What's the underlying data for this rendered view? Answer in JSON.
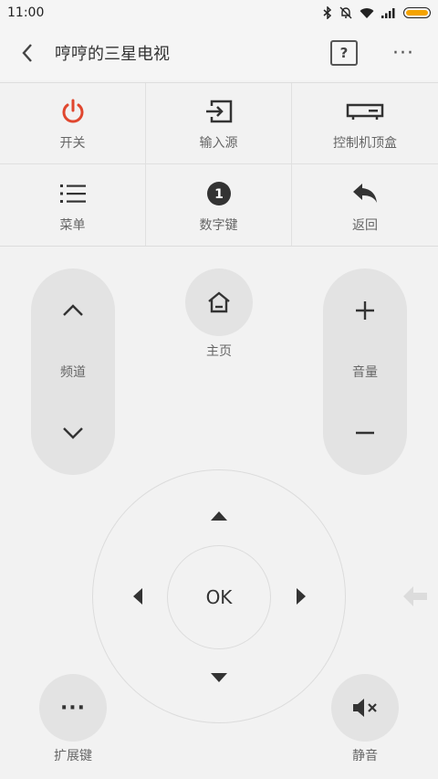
{
  "status": {
    "time": "11:00"
  },
  "appbar": {
    "title": "哼哼的三星电视",
    "help_label": "?",
    "more_label": "···"
  },
  "grid": {
    "items": [
      {
        "label": "开关",
        "icon": "power-icon",
        "color": "#e0472f"
      },
      {
        "label": "输入源",
        "icon": "input-source-icon"
      },
      {
        "label": "控制机顶盒",
        "icon": "set-top-box-icon"
      },
      {
        "label": "菜单",
        "icon": "menu-list-icon"
      },
      {
        "label": "数字键",
        "icon": "number-keys-icon",
        "badge": "1"
      },
      {
        "label": "返回",
        "icon": "return-icon"
      }
    ]
  },
  "channel": {
    "label": "频道"
  },
  "home": {
    "label": "主页"
  },
  "volume": {
    "label": "音量"
  },
  "dpad": {
    "ok_label": "OK"
  },
  "extended": {
    "label": "扩展键",
    "glyph": "···"
  },
  "mute": {
    "label": "静音"
  },
  "colors": {
    "power": "#e0472f",
    "button_bg": "#e3e3e3",
    "background": "#f2f2f2"
  }
}
